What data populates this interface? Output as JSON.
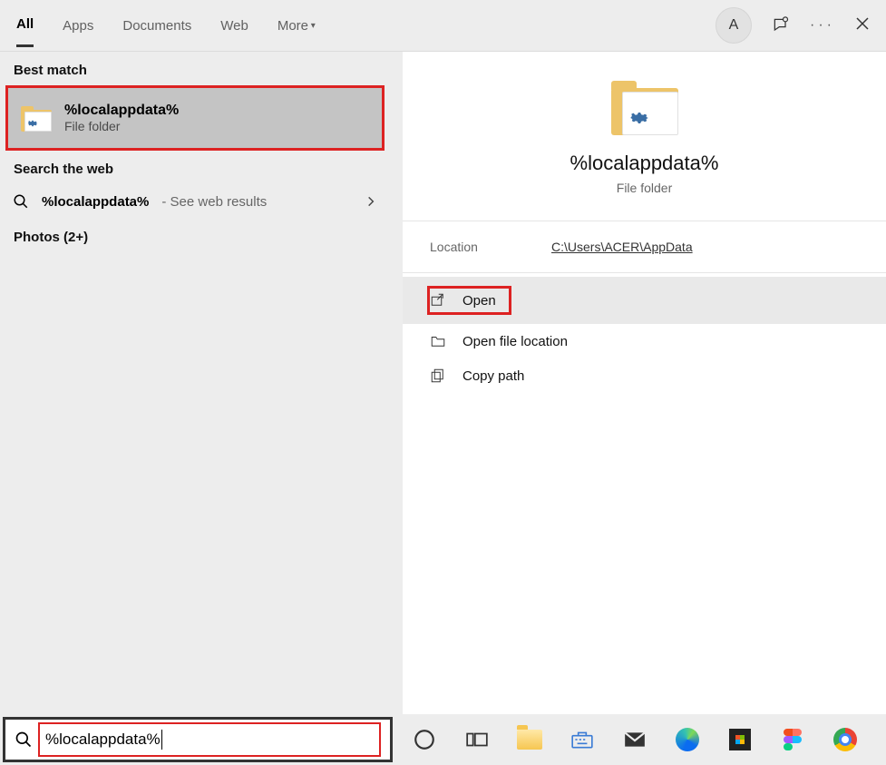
{
  "tabs": {
    "all": "All",
    "apps": "Apps",
    "documents": "Documents",
    "web": "Web",
    "more": "More"
  },
  "avatar_initial": "A",
  "best_match_header": "Best match",
  "best_match": {
    "title": "%localappdata%",
    "subtitle": "File folder"
  },
  "search_web_header": "Search the web",
  "web_result": {
    "query": "%localappdata%",
    "suffix": " - See web results"
  },
  "photos_header": "Photos (2+)",
  "preview": {
    "title": "%localappdata%",
    "subtitle": "File folder"
  },
  "location": {
    "label": "Location",
    "path": "C:\\Users\\ACER\\AppData"
  },
  "actions": {
    "open": "Open",
    "open_location": "Open file location",
    "copy_path": "Copy path"
  },
  "search_value": "%localappdata%"
}
